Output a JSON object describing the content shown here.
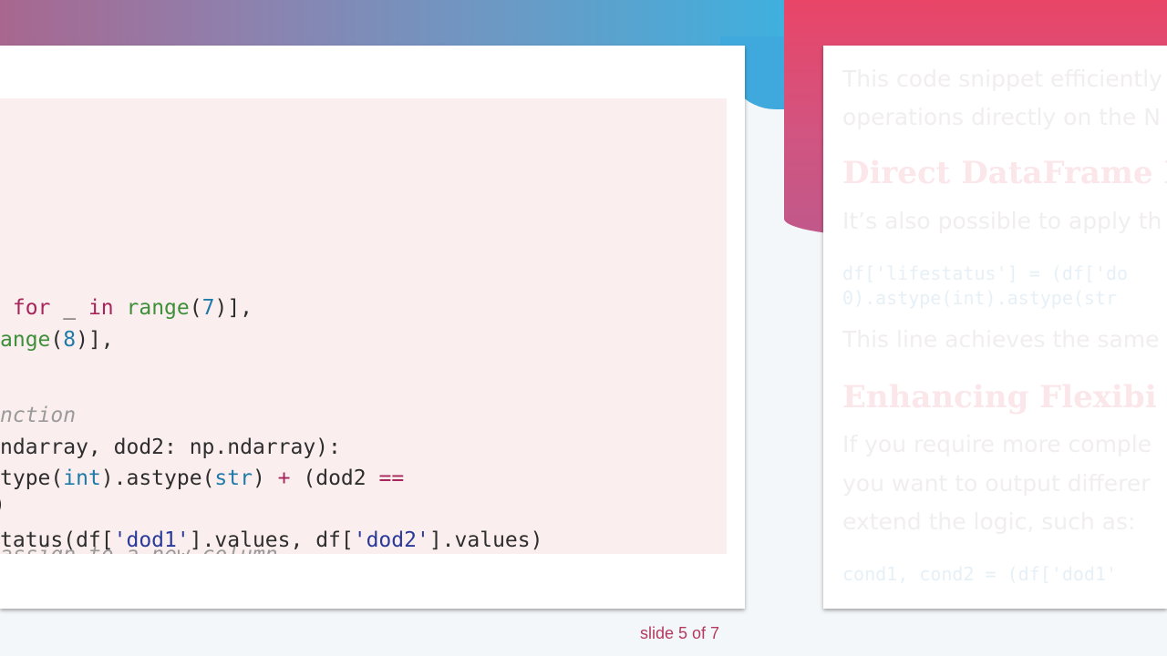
{
  "code": {
    "line1": {
      "a": " for ",
      "b": "_",
      "c": " in ",
      "d": "range",
      "e": "(",
      "f": "7",
      "g": ")],"
    },
    "line2": {
      "a": "ange",
      "b": "(",
      "c": "8",
      "d": ")],"
    },
    "line3": {
      "comment": "nction"
    },
    "line4": {
      "text": "ndarray, dod2: np.ndarray):"
    },
    "line5": {
      "a": "type(",
      "b": "int",
      "c": ").astype(",
      "d": "str",
      "e": ") ",
      "f": "+",
      "g": " (dod2 ",
      "h": "=="
    },
    "line6": {
      "text": ")"
    },
    "line7": {
      "comment": "assign to a new column"
    },
    "line8": {
      "a": "tatus(df[",
      "b": "'dod1'",
      "c": "].values, df[",
      "d": "'dod2'",
      "e": "].values)"
    }
  },
  "right_slide": {
    "p1_l1": "This code snippet efficiently",
    "p1_l2": "operations directly on the N",
    "h1": "Direct DataFrame M",
    "p2": "It’s also possible to apply th",
    "code_l1": "df['lifestatus'] = (df['do",
    "code_l2": "0).astype(int).astype(str",
    "p3": "This line achieves the same",
    "h2": "Enhancing Flexibi",
    "p4_l1": "If you require more comple",
    "p4_l2": "you want to output differer",
    "p4_l3": "extend the logic, such as:",
    "code2": "cond1, cond2 = (df['dod1'"
  },
  "footer": {
    "slide_counter": "slide 5 of 7"
  },
  "colors": {
    "accent_pink": "#e94567",
    "accent_blue": "#3fb0de",
    "counter_text": "#b23a5e"
  }
}
